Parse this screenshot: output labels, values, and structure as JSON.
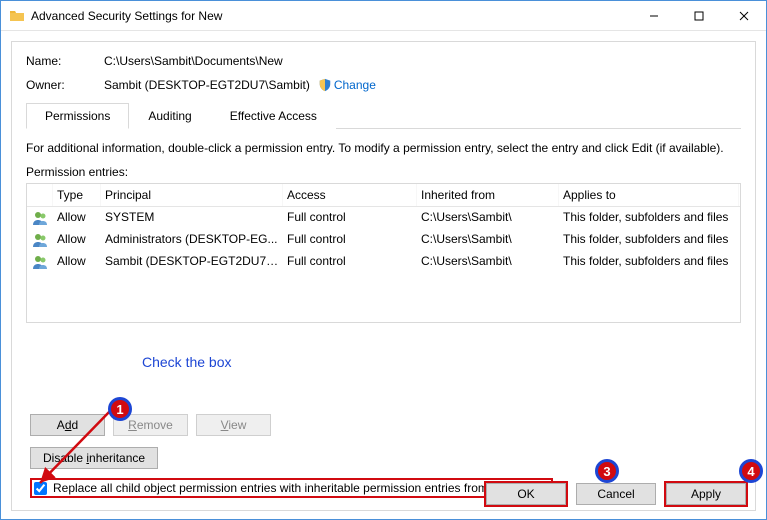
{
  "window": {
    "title": "Advanced Security Settings for New"
  },
  "info": {
    "name_label": "Name:",
    "name_value": "C:\\Users\\Sambit\\Documents\\New",
    "owner_label": "Owner:",
    "owner_value": "Sambit (DESKTOP-EGT2DU7\\Sambit)",
    "change_text": "Change"
  },
  "tabs": {
    "permissions": "Permissions",
    "auditing": "Auditing",
    "effective": "Effective Access"
  },
  "instruction": "For additional information, double-click a permission entry. To modify a permission entry, select the entry and click Edit (if available).",
  "entries_label": "Permission entries:",
  "columns": {
    "type": "Type",
    "principal": "Principal",
    "access": "Access",
    "inherited": "Inherited from",
    "applies": "Applies to"
  },
  "rows": [
    {
      "type": "Allow",
      "principal": "SYSTEM",
      "access": "Full control",
      "inherited": "C:\\Users\\Sambit\\",
      "applies": "This folder, subfolders and files"
    },
    {
      "type": "Allow",
      "principal": "Administrators (DESKTOP-EG...",
      "access": "Full control",
      "inherited": "C:\\Users\\Sambit\\",
      "applies": "This folder, subfolders and files"
    },
    {
      "type": "Allow",
      "principal": "Sambit (DESKTOP-EGT2DU7\\S...",
      "access": "Full control",
      "inherited": "C:\\Users\\Sambit\\",
      "applies": "This folder, subfolders and files"
    }
  ],
  "annotation": {
    "check_text": "Check the box"
  },
  "buttons": {
    "add": "Add",
    "remove": "Remove",
    "view": "View",
    "disable_inheritance": "Disable inheritance",
    "ok": "OK",
    "cancel": "Cancel",
    "apply": "Apply"
  },
  "checkbox": {
    "label": "Replace all child object permission entries with inheritable permission entries from this object",
    "checked": true
  },
  "badges": {
    "b1": "1",
    "b3": "3",
    "b4": "4"
  }
}
